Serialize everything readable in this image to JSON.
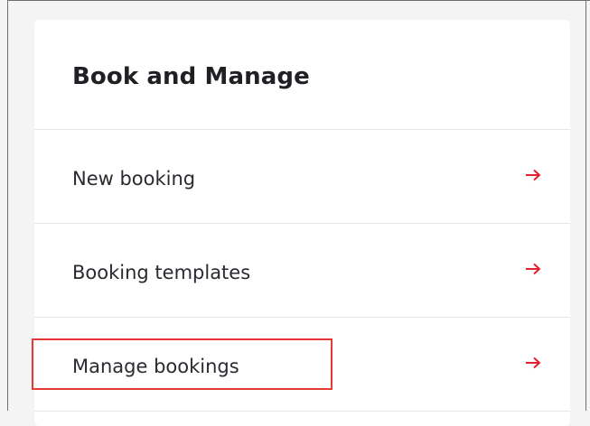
{
  "panel": {
    "title": "Book and Manage",
    "items": [
      {
        "label": "New booking",
        "icon": "arrow-right-icon"
      },
      {
        "label": "Booking templates",
        "icon": "arrow-right-icon"
      },
      {
        "label": "Manage bookings",
        "icon": "arrow-right-icon"
      }
    ]
  },
  "colors": {
    "accent_arrow": "#e0202a",
    "highlight": "#e53935"
  },
  "highlighted_item": "Manage bookings"
}
